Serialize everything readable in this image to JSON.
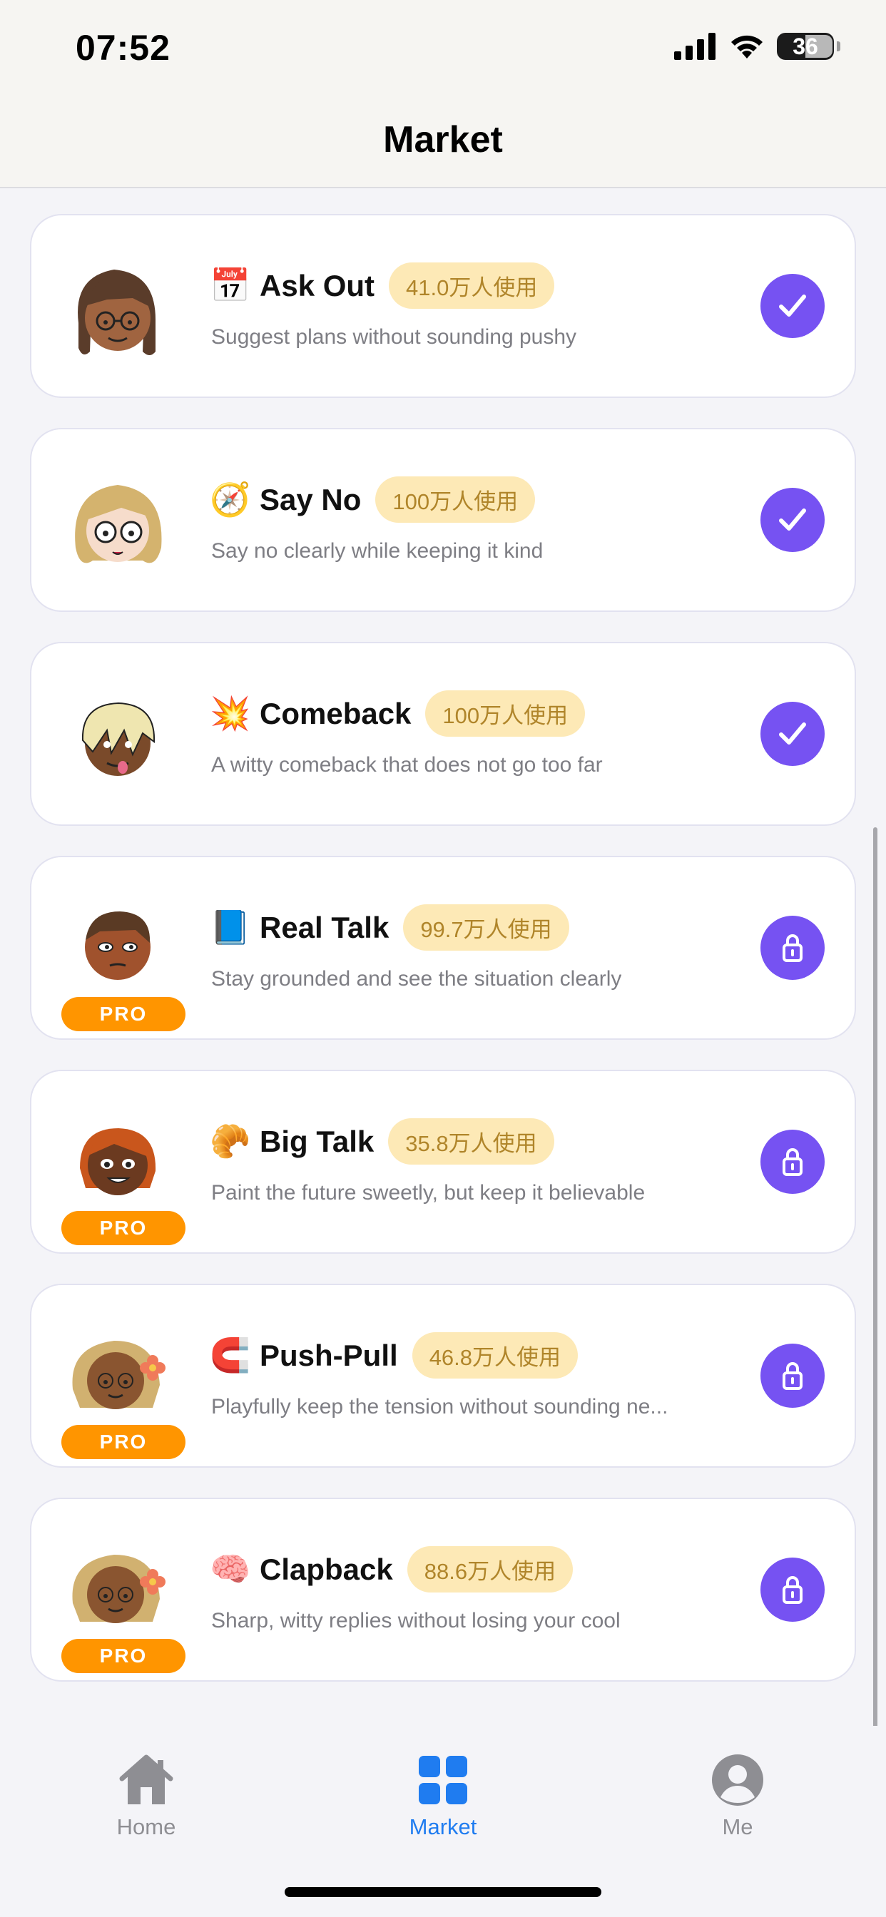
{
  "status_bar": {
    "time": "07:52",
    "battery": "36"
  },
  "header": {
    "title": "Market"
  },
  "items": [
    {
      "emoji": "📅",
      "title": "Ask Out",
      "usage": "41.0万人使用",
      "description": "Suggest plans without sounding pushy",
      "pro": false,
      "status": "checked"
    },
    {
      "emoji": "🧭",
      "title": "Say No",
      "usage": "100万人使用",
      "description": "Say no clearly while keeping it kind",
      "pro": false,
      "status": "checked"
    },
    {
      "emoji": "💥",
      "title": "Comeback",
      "usage": "100万人使用",
      "description": "A witty comeback that does not go too far",
      "pro": false,
      "status": "checked"
    },
    {
      "emoji": "📘",
      "title": "Real Talk",
      "usage": "99.7万人使用",
      "description": "Stay grounded and see the situation clearly",
      "pro": true,
      "pro_label": "PRO",
      "status": "locked"
    },
    {
      "emoji": "🥐",
      "title": "Big Talk",
      "usage": "35.8万人使用",
      "description": "Paint the future sweetly, but keep it believable",
      "pro": true,
      "pro_label": "PRO",
      "status": "locked"
    },
    {
      "emoji": "🧲",
      "title": "Push-Pull",
      "usage": "46.8万人使用",
      "description": "Playfully keep the tension without sounding ne...",
      "pro": true,
      "pro_label": "PRO",
      "status": "locked"
    },
    {
      "emoji": "🧠",
      "title": "Clapback",
      "usage": "88.6万人使用",
      "description": "Sharp, witty replies without losing your cool",
      "pro": true,
      "pro_label": "PRO",
      "status": "locked"
    }
  ],
  "tab_bar": {
    "tabs": [
      {
        "label": "Home",
        "icon": "house-icon",
        "active": false
      },
      {
        "label": "Market",
        "icon": "grid-icon",
        "active": true
      },
      {
        "label": "Me",
        "icon": "person-circle-icon",
        "active": false
      }
    ]
  },
  "colors": {
    "accent_purple": "#7652f2",
    "pro_orange": "#ff9500",
    "usage_badge_bg": "#fde9b6",
    "usage_badge_text": "#b0852a",
    "tab_active": "#1f7cf0",
    "tab_inactive": "#8e8e93"
  }
}
